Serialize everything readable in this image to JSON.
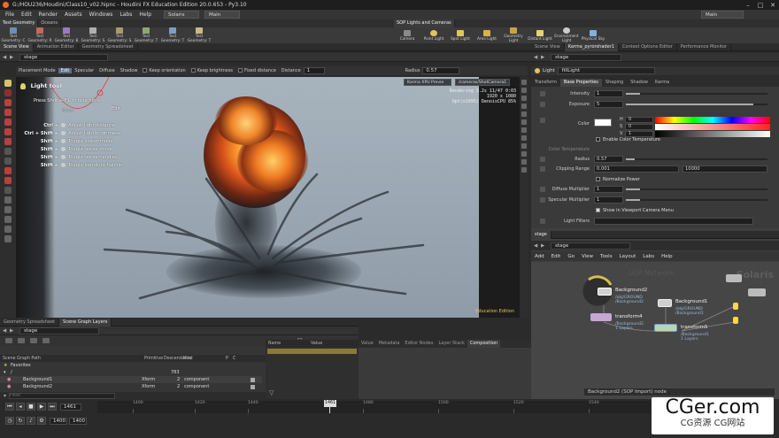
{
  "titlebar": {
    "title": "G:/HOU236/Houdini/Class10_v02.hipnc - Houdini FX Education Edition 20.0.653 - Py3.10"
  },
  "menubar": {
    "items": [
      "File",
      "Edit",
      "Render",
      "Assets",
      "Windows",
      "Labs",
      "Help"
    ],
    "desktop": "Solaris",
    "context": "Main",
    "right_dropdown": "Main"
  },
  "shelf_left": {
    "tabs": [
      "Test Geometry",
      "Oceans"
    ],
    "tools": [
      "Test Geometry: C",
      "Test Geometry: R",
      "Test Geometry: B",
      "Test Geometry: S",
      "Test Geometry: S",
      "Test Geometry: T",
      "Test Geometry: T",
      "Test Geometry: T"
    ]
  },
  "shelf_right": {
    "tabs": [
      "SOP Lights and Cameras"
    ],
    "tools": [
      "Camera",
      "Point Light",
      "Spot Light",
      "Area Light",
      "Geometry Light",
      "Distant Light",
      "Environment Light",
      "Physical Sky"
    ]
  },
  "viewer_tabs": [
    "Scene View",
    "Animation Editor",
    "Geometry Spreadsheet"
  ],
  "viewer_path": "stage",
  "options_bar": {
    "placement_mode": "Placement Mode",
    "modes": [
      "Edit",
      "Specular",
      "Diffuse",
      "Shadow"
    ],
    "keep_orientation": "Keep orientation",
    "keep_brightness": "Keep brightness",
    "fixed_distance": "Fixed distance",
    "distance_label": "Distance",
    "distance_value": "1",
    "radius_label": "Radius",
    "radius_value": "0.57"
  },
  "viewport": {
    "renderer": "Karma XPU Previe",
    "camera": "/cameras/ShotCamera1",
    "render_info": [
      "Rendering  3.2s  11/47  0:03",
      "1920 x 1080",
      "Opt(x1995) DenoisCPU  85%"
    ],
    "edition_badge": "Education Edition",
    "light_tool": {
      "title": "Light tool",
      "hint": "Press Shift + F1 to hide hints",
      "sub_mode_label": "Move",
      "edit_label": "Edit",
      "hotkeys": [
        {
          "key": "Ctrl +",
          "action": "Adjust light distance"
        },
        {
          "key": "Ctrl + Shift +",
          "action": "Adjust light brightness"
        },
        {
          "key": "Shift +",
          "action": "Toggle lookat mode"
        },
        {
          "key": "Shift +",
          "action": "Toggle resize mode"
        },
        {
          "key": "Shift +",
          "action": "Toggle resize handles"
        },
        {
          "key": "Shift +",
          "action": "Toggle barndoor handle"
        }
      ]
    }
  },
  "params": {
    "tabs_top": [
      "Scene View",
      "Karma_pyrorshader1",
      "Context Options Editor",
      "Performance Monitor"
    ],
    "node_type": "Light",
    "node_name": "fillLight",
    "tabs": [
      "Transform",
      "Base Properties",
      "Shaping",
      "Shadow",
      "Karma"
    ],
    "intensity_label": "Intensity",
    "intensity_value": "1",
    "intensity_fill": 0.1,
    "exposure_label": "Exposure",
    "exposure_value": "5",
    "exposure_fill": 0.9,
    "color_label": "Color",
    "color_channels": [
      {
        "name": "H",
        "value": "0"
      },
      {
        "name": "S",
        "value": "0"
      },
      {
        "name": "V",
        "value": "1"
      }
    ],
    "enable_color_temp": "Enable Color Temperature",
    "color_temp_label": "Color Temperature",
    "radius_label": "Radius",
    "radius_value": "0.57",
    "radius_fill": 0.06,
    "clipping_label": "Clipping Range",
    "clipping_min": "0.001",
    "clipping_max": "10000",
    "normalize_power": "Normalize Power",
    "diffuse_label": "Diffuse Multiplier",
    "diffuse_value": "1",
    "specular_label": "Specular Multiplier",
    "specular_value": "1",
    "show_in_viewport": "Show in Viewport Camera Menu",
    "light_filters": "Light Filters"
  },
  "network": {
    "tabs": [
      "stage"
    ],
    "path": "stage",
    "menu": [
      "Add",
      "Edit",
      "Go",
      "View",
      "Tools",
      "Layout",
      "Labs",
      "Help"
    ],
    "watermark_solaris": "Solaris",
    "watermark_lop": "LOP Network",
    "nodes": [
      {
        "name": "Background2",
        "sub": "/obj/GROUND\n/Background2"
      },
      {
        "name": "Background1",
        "sub": "/obj/GROUND\n/Background1"
      },
      {
        "name": "transform4",
        "sub": "/Background2\n1 Layers"
      },
      {
        "name": "transform5",
        "sub": "/Background1\n1 Layers"
      }
    ],
    "status_node": "Background2 (SOP Import) node"
  },
  "scene_graph": {
    "tabs": [
      "Geometry Spreadsheet",
      "Scene Graph Layers"
    ],
    "path": "stage",
    "columns": [
      "Scene Graph Path",
      "Primitive",
      "Descendants",
      "Kind",
      "P",
      "C"
    ],
    "rows": [
      {
        "path": "Favorites",
        "prim": "",
        "desc": "",
        "kind": ""
      },
      {
        "path": "/",
        "prim": "",
        "desc": "783",
        "kind": ""
      },
      {
        "path": "Background1",
        "prim": "Xform",
        "desc": "2",
        "kind": "component"
      },
      {
        "path": "Background2",
        "prim": "Xform",
        "desc": "2",
        "kind": "component"
      }
    ],
    "filter_placeholder": "Filter",
    "attr_columns": [
      "Name",
      "Value"
    ]
  },
  "details": {
    "tabs": [
      "Value",
      "Metadata",
      "Editor Nodes",
      "Layer Stack",
      "Composition"
    ]
  },
  "timeline": {
    "current_frame": "1461",
    "start": "1400",
    "end": "1400",
    "ticks": [
      "1400",
      "1420",
      "1440",
      "1461",
      "1480",
      "1500",
      "1520",
      "1540"
    ]
  },
  "watermark": {
    "line1": "CGer.com",
    "line2": "CG资源  CG网站"
  },
  "colors": {
    "accent": "#f2a43a",
    "node_selected": "#ffd54a",
    "link": "#6fa9e0"
  }
}
